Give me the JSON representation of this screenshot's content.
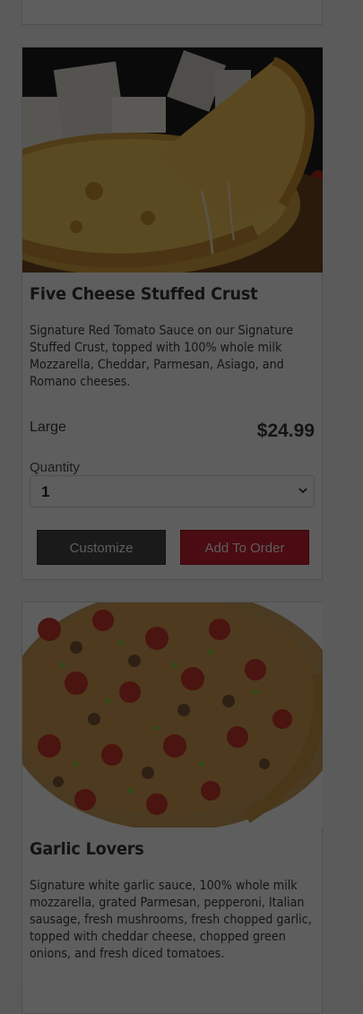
{
  "menu_items": [
    {
      "title": "Five Cheese Stuffed Crust",
      "description": "Signature Red Tomato Sauce on our Signature Stuffed Crust, topped with 100% whole milk Mozzarella, Cheddar, Parmesan, Asiago, and Romano cheeses.",
      "size_label": "Large",
      "price": "$24.99",
      "quantity_label": "Quantity",
      "quantity_value": "1",
      "customize_label": "Customize",
      "add_label": "Add To Order"
    },
    {
      "title": "Garlic Lovers",
      "description": "Signature white garlic sauce, 100% whole milk mozzarella, grated Parmesan, pepperoni, Italian sausage, fresh mushrooms, fresh chopped garlic, topped with cheddar cheese, chopped green onions, and fresh diced tomatoes."
    }
  ],
  "icons": {
    "dropdown": "chevron-down-icon"
  },
  "colors": {
    "button_dark": "#1a1a1a",
    "button_red": "#4b0b12",
    "overlay": "#5b5b5b"
  }
}
